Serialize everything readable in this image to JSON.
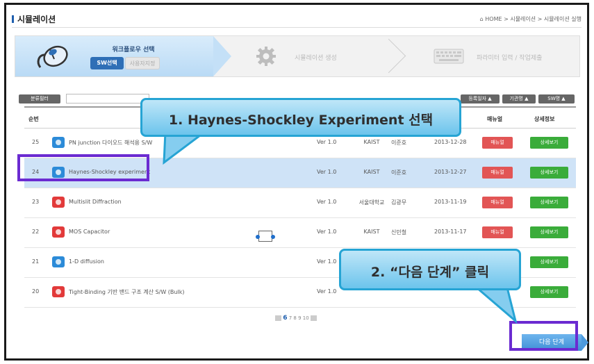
{
  "header": {
    "title": "시뮬레이션",
    "breadcrumb": "HOME > 시뮬레이션 > 시뮬레이션 실행"
  },
  "steps": {
    "step1": {
      "title": "워크플로우 선택",
      "sw_button": "SW선택",
      "user_button": "사용자지정",
      "icon": "mouse-icon"
    },
    "step2": {
      "label": "시뮬레이션 생성",
      "icon": "gear-icon"
    },
    "step3": {
      "label": "파라미터 입력 / 작업제출",
      "icon": "keyboard-icon"
    }
  },
  "filter": {
    "filter_label": "분류필터",
    "search_placeholder": "",
    "sort_date": "등록일자 ▲",
    "sort_org": "기관명 ▲",
    "sort_sw": "SW명 ▲"
  },
  "table": {
    "headers": {
      "num": "순번",
      "manual": "매뉴얼",
      "detail": "상세정보"
    },
    "rows": [
      {
        "num": "25",
        "icon_color": "blue",
        "name": "PN junction 다이오드 해석용 S/W",
        "ver": "Ver 1.0",
        "org": "KAIST",
        "author": "이준호",
        "date": "2013-12-28",
        "manual": "매뉴얼",
        "detail": "상세보기"
      },
      {
        "num": "24",
        "icon_color": "blue",
        "name": "Haynes-Shockley experiment",
        "ver": "Ver 1.0",
        "org": "KAIST",
        "author": "이준호",
        "date": "2013-12-27",
        "manual": "매뉴얼",
        "detail": "상세보기"
      },
      {
        "num": "23",
        "icon_color": "red",
        "name": "Multislit Diffraction",
        "ver": "Ver 1.0",
        "org": "서울대학교",
        "author": "김광무",
        "date": "2013-11-19",
        "manual": "매뉴얼",
        "detail": "상세보기"
      },
      {
        "num": "22",
        "icon_color": "red",
        "name": "MOS Capacitor",
        "ver": "Ver 1.0",
        "org": "KAIST",
        "author": "신민철",
        "date": "2013-11-17",
        "manual": "매뉴얼",
        "detail": "상세보기"
      },
      {
        "num": "21",
        "icon_color": "blue",
        "name": "1-D diffusion",
        "ver": "Ver 1.0",
        "org": "",
        "author": "",
        "date": "",
        "manual": "",
        "detail": "상세보기"
      },
      {
        "num": "20",
        "icon_color": "red",
        "name": "Tight-Binding 기반 밴드 구조 계산 S/W (Bulk)",
        "ver": "Ver 1.0",
        "org": "",
        "author": "",
        "date": "",
        "manual": "",
        "detail": "상세보기"
      }
    ]
  },
  "pagination": {
    "current": "6",
    "others": "7 8 9 10"
  },
  "next_button": "다음 단계",
  "callouts": {
    "first": "1. Haynes-Shockley Experiment 선택",
    "second": "2. “다음 단계” 클릭"
  },
  "colors": {
    "accent": "#1f5fae",
    "highlight_border": "#6b2bd1",
    "callout": "#26a4d4",
    "manual_btn": "#e25555",
    "detail_btn": "#3aac3a",
    "selected_row": "#cfe3f7"
  }
}
